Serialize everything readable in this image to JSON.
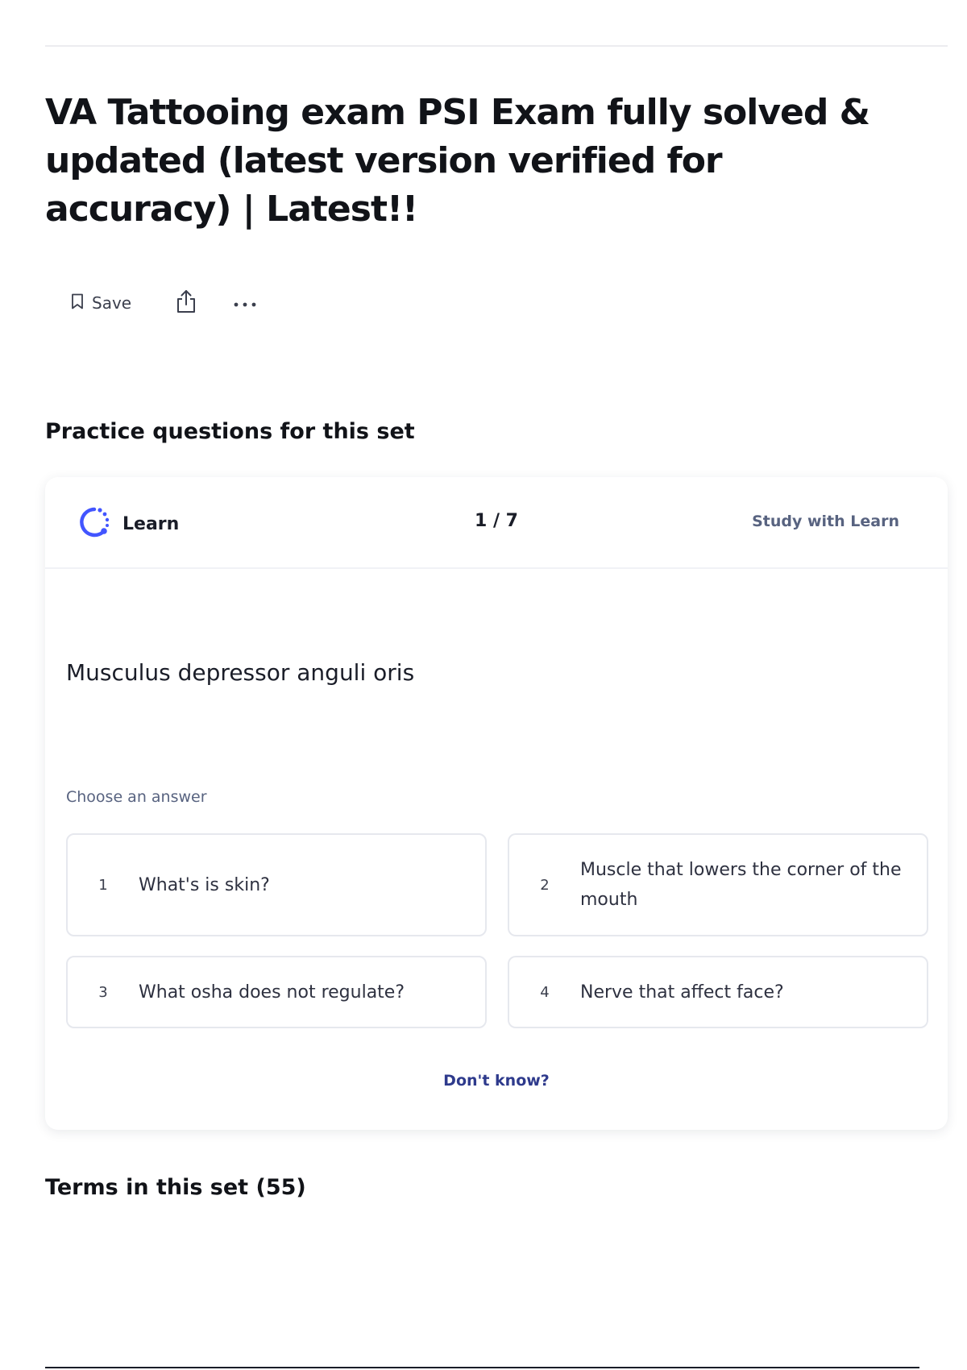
{
  "page": {
    "title": "VA Tattooing exam PSI Exam fully solved & updated (latest version verified for accuracy) | Latest!!"
  },
  "toolbar": {
    "save_label": "Save",
    "save_icon": "bookmark-icon",
    "share_icon": "share-icon",
    "more_icon": "more-horizontal-icon"
  },
  "practice": {
    "heading": "Practice questions for this set",
    "card": {
      "mode_icon": "learn-mode-icon",
      "mode_label": "Learn",
      "progress": "1 / 7",
      "study_link": "Study with Learn",
      "term": "Musculus depressor anguli oris",
      "prompt": "Choose an answer",
      "options": [
        {
          "number": "1",
          "text": "What's is skin?"
        },
        {
          "number": "2",
          "text": "Muscle that lowers the corner of the mouth"
        },
        {
          "number": "3",
          "text": "What osha does not regulate?"
        },
        {
          "number": "4",
          "text": "Nerve that affect face?"
        }
      ],
      "dont_know": "Don't know?"
    }
  },
  "terms": {
    "heading": "Terms in this set (55)"
  },
  "colors": {
    "accent": "#4255ff",
    "link": "#2e3a8c",
    "muted_text": "#586380",
    "border": "#e6e8ee"
  }
}
